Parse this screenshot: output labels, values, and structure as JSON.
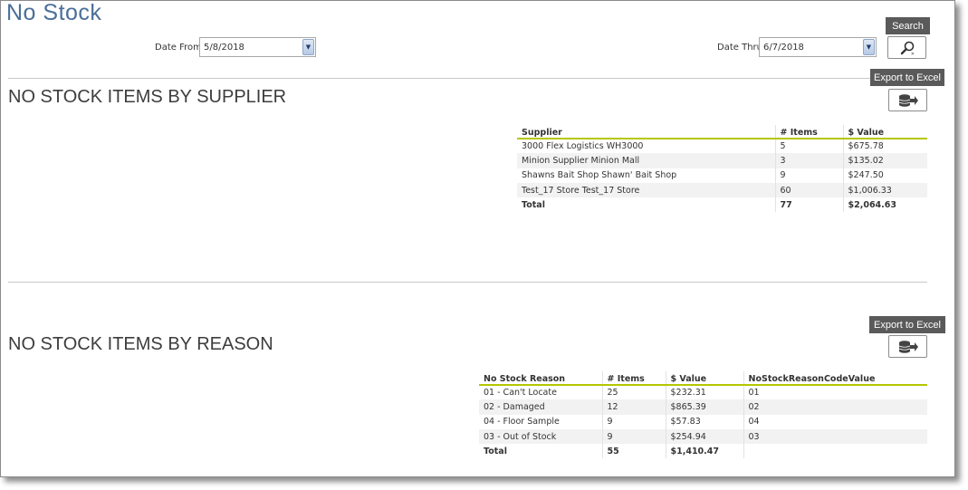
{
  "page": {
    "title": "No Stock"
  },
  "filters": {
    "date_from_label": "Date From",
    "date_from_value": "5/8/2018",
    "date_thru_label": "Date Thru",
    "date_thru_value": "6/7/2018"
  },
  "search": {
    "label": "Search",
    "icon": "magnifier-icon"
  },
  "supplier_section": {
    "title": "NO STOCK ITEMS BY SUPPLIER",
    "export_label": "Export to Excel",
    "columns": [
      "Supplier",
      "# Items",
      "$ Value"
    ],
    "rows": [
      [
        "3000 Flex Logistics WH3000",
        "5",
        "$675.78"
      ],
      [
        "Minion Supplier Minion Mall",
        "3",
        "$135.02"
      ],
      [
        "Shawns Bait Shop Shawn' Bait Shop",
        "9",
        "$247.50"
      ],
      [
        "Test_17 Store Test_17 Store",
        "60",
        "$1,006.33"
      ]
    ],
    "total": [
      "Total",
      "77",
      "$2,064.63"
    ]
  },
  "reason_section": {
    "title": "NO STOCK ITEMS BY REASON",
    "export_label": "Export to Excel",
    "columns": [
      "No Stock Reason",
      "# Items",
      "$ Value",
      "NoStockReasonCodeValue"
    ],
    "rows": [
      [
        "01 - Can't Locate",
        "25",
        "$232.31",
        "01"
      ],
      [
        "02 - Damaged",
        "12",
        "$865.39",
        "02"
      ],
      [
        "04 - Floor Sample",
        "9",
        "$57.83",
        "04"
      ],
      [
        "03 - Out of Stock",
        "9",
        "$254.94",
        "03"
      ]
    ],
    "total": [
      "Total",
      "55",
      "$1,410.47",
      ""
    ]
  },
  "colors": {
    "title_blue": "#4a6f9a",
    "header_rule": "#b5c700",
    "button_dark": "#5a5a5a"
  }
}
